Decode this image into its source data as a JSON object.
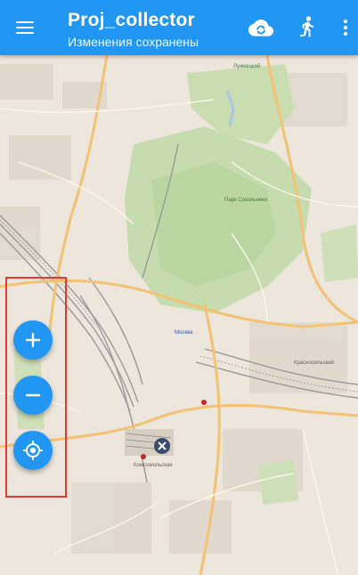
{
  "toolbar": {
    "title": "Proj_collector",
    "subtitle": "Изменения сохранены",
    "menu_icon": "hamburger-menu-icon",
    "cloud_icon": "cloud-sync-icon",
    "walk_icon": "walking-person-icon",
    "more_icon": "more-vertical-icon"
  },
  "map": {
    "zoom_in_icon": "plus-icon",
    "zoom_out_icon": "minus-icon",
    "locate_icon": "my-location-icon",
    "labels": {
      "park_top": "Лужнецкий\nпарк",
      "park_main": "Парк Сокольники",
      "metro": "Москва\nКаланчёвская",
      "station": "Комсомольская",
      "east": "Красносельский"
    }
  },
  "colors": {
    "toolbar": "#2196f3",
    "fab": "#2196f3",
    "highlight": "#e53935",
    "park": "#c8dcb0",
    "road_major": "#f5c16c",
    "rail": "#9a9a9a"
  }
}
